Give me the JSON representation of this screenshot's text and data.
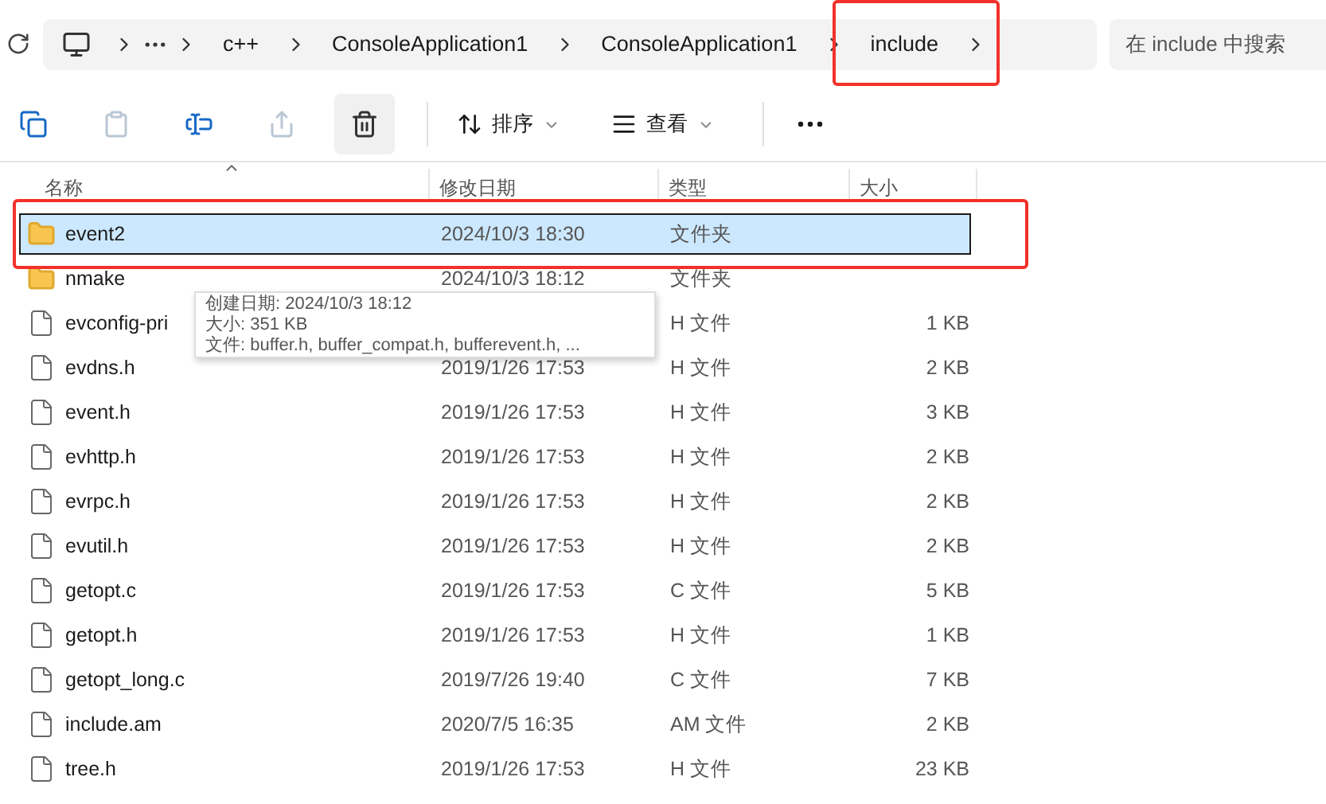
{
  "address_bar": {
    "breadcrumb": [
      {
        "label": "c++"
      },
      {
        "label": "ConsoleApplication1"
      },
      {
        "label": "ConsoleApplication1"
      },
      {
        "label": "include"
      }
    ]
  },
  "search": {
    "placeholder": "在 include 中搜索"
  },
  "toolbar": {
    "icon_buttons": [
      {
        "kind": "copy",
        "disabled": false,
        "hovered": false
      },
      {
        "kind": "paste",
        "disabled": true,
        "hovered": false
      },
      {
        "kind": "rename",
        "disabled": false,
        "hovered": false
      },
      {
        "kind": "share",
        "disabled": true,
        "hovered": false
      },
      {
        "kind": "delete",
        "disabled": false,
        "hovered": true
      }
    ],
    "menus": [
      {
        "kind": "sort",
        "label": "排序"
      },
      {
        "kind": "view",
        "label": "查看"
      }
    ]
  },
  "table": {
    "columns": [
      {
        "label": "名称",
        "sorted": true
      },
      {
        "label": "修改日期",
        "sorted": false
      },
      {
        "label": "类型",
        "sorted": false
      },
      {
        "label": "大小",
        "sorted": false
      }
    ],
    "rows": [
      {
        "kind": "folder",
        "name": "event2",
        "date": "2024/10/3 18:30",
        "type": "文件夹",
        "selected": true
      },
      {
        "kind": "folder",
        "name": "nmake",
        "date": "2024/10/3 18:12",
        "type": "文件夹",
        "selected": false
      },
      {
        "kind": "file",
        "name": "evconfig-pri",
        "type": "H 文件",
        "size": "1 KB",
        "selected": false
      },
      {
        "kind": "file",
        "name": "evdns.h",
        "date": "2019/1/26 17:53",
        "type": "H 文件",
        "size": "2 KB",
        "selected": false
      },
      {
        "kind": "file",
        "name": "event.h",
        "date": "2019/1/26 17:53",
        "type": "H 文件",
        "size": "3 KB",
        "selected": false
      },
      {
        "kind": "file",
        "name": "evhttp.h",
        "date": "2019/1/26 17:53",
        "type": "H 文件",
        "size": "2 KB",
        "selected": false
      },
      {
        "kind": "file",
        "name": "evrpc.h",
        "date": "2019/1/26 17:53",
        "type": "H 文件",
        "size": "2 KB",
        "selected": false
      },
      {
        "kind": "file",
        "name": "evutil.h",
        "date": "2019/1/26 17:53",
        "type": "H 文件",
        "size": "2 KB",
        "selected": false
      },
      {
        "kind": "file",
        "name": "getopt.c",
        "date": "2019/1/26 17:53",
        "type": "C 文件",
        "size": "5 KB",
        "selected": false
      },
      {
        "kind": "file",
        "name": "getopt.h",
        "date": "2019/1/26 17:53",
        "type": "H 文件",
        "size": "1 KB",
        "selected": false
      },
      {
        "kind": "file",
        "name": "getopt_long.c",
        "date": "2019/7/26 19:40",
        "type": "C 文件",
        "size": "7 KB",
        "selected": false
      },
      {
        "kind": "file",
        "name": "include.am",
        "date": "2020/7/5 16:35",
        "type": "AM 文件",
        "size": "2 KB",
        "selected": false
      },
      {
        "kind": "file",
        "name": "tree.h",
        "date": "2019/1/26 17:53",
        "type": "H 文件",
        "size": "23 KB",
        "selected": false
      }
    ]
  },
  "tooltip": {
    "lines": [
      "创建日期: 2024/10/3 18:12",
      "大小: 351 KB",
      "文件: buffer.h, buffer_compat.h, bufferevent.h, ..."
    ]
  }
}
